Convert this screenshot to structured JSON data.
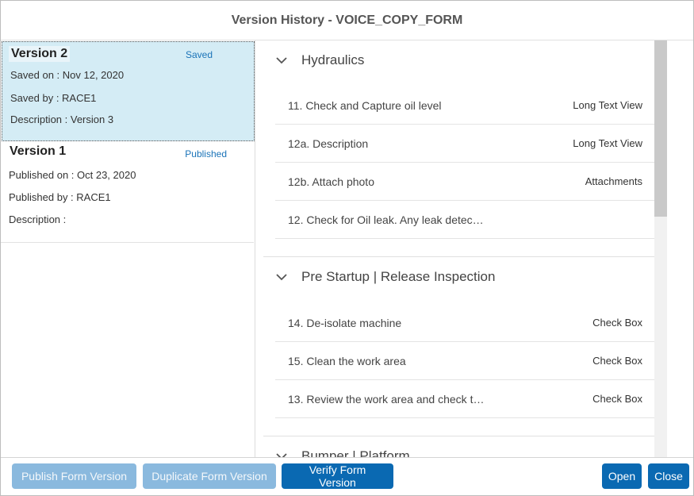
{
  "dialog": {
    "title": "Version History - VOICE_COPY_FORM"
  },
  "versions": [
    {
      "name": "Version 2",
      "status": "Saved",
      "date_line": "Saved on : Nov 12, 2020",
      "by_line": "Saved by : RACE1",
      "description_line": "Description : Version 3"
    },
    {
      "name": "Version 1",
      "status": "Published",
      "date_line": "Published on : Oct 23, 2020",
      "by_line": "Published by : RACE1",
      "description_line": "Description :"
    }
  ],
  "sections": [
    {
      "title": "Hydraulics",
      "icon": "chevron-down-icon",
      "rows": [
        {
          "label": "11. Check and Capture oil level",
          "type": "Long Text View"
        },
        {
          "label": "12a. Description",
          "type": "Long Text View"
        },
        {
          "label": "12b. Attach photo",
          "type": "Attachments"
        },
        {
          "label": "12. Check for Oil leak. Any leak detec…",
          "type": ""
        }
      ]
    },
    {
      "title": "Pre Startup | Release Inspection",
      "icon": "chevron-down-icon",
      "rows": [
        {
          "label": "14. De-isolate machine",
          "type": "Check Box"
        },
        {
          "label": "15. Clean the work area",
          "type": "Check Box"
        },
        {
          "label": "13. Review the work area and check t…",
          "type": "Check Box"
        }
      ]
    },
    {
      "title": "Bumper | Platform",
      "icon": "chevron-down-icon",
      "rows": []
    }
  ],
  "footer": {
    "publish_label": "Publish Form Version",
    "duplicate_label": "Duplicate Form Version",
    "verify_label": "Verify Form Version",
    "open_label": "Open",
    "close_label": "Close"
  },
  "colors": {
    "primary": "#0a69b2",
    "disabled": "#8ab9de",
    "selected_bg": "#d4ecf5",
    "status_link": "#1a73b8"
  }
}
